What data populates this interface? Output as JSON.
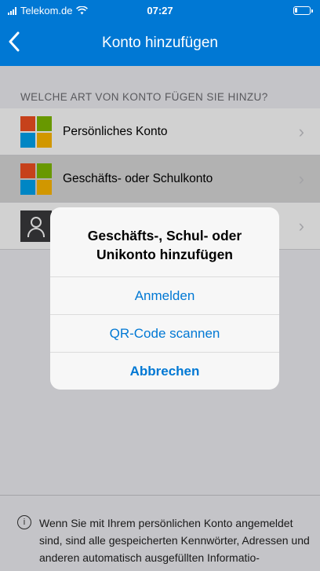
{
  "status_bar": {
    "carrier": "Telekom.de",
    "time": "07:27",
    "wifi_icon": "wifi-icon",
    "battery_icon": "battery-icon"
  },
  "nav": {
    "back_icon": "chevron-left-icon",
    "title": "Konto hinzufügen"
  },
  "section_header": "WELCHE ART VON KONTO FÜGEN SIE HINZU?",
  "rows": [
    {
      "label": "Persönliches Konto",
      "icon": "microsoft-logo-icon"
    },
    {
      "label": "Geschäfts- oder Schulkonto",
      "icon": "microsoft-logo-icon"
    },
    {
      "label": "",
      "icon": "person-icon"
    }
  ],
  "alert": {
    "title": "Geschäfts-, Schul- oder Unikonto hinzufügen",
    "buttons": {
      "sign_in": "Anmelden",
      "scan_qr": "QR-Code scannen",
      "cancel": "Abbrechen"
    }
  },
  "footer": {
    "info_icon": "info-icon",
    "text": "Wenn Sie mit Ihrem persönlichen Konto angemeldet sind, sind alle gespeicherten Kennwörter, Adressen und anderen automatisch ausgefüllten Informatio-"
  },
  "colors": {
    "accent": "#0078d4",
    "ms_red": "#f25022",
    "ms_green": "#7fba00",
    "ms_blue": "#00a4ef",
    "ms_yellow": "#ffb900"
  }
}
